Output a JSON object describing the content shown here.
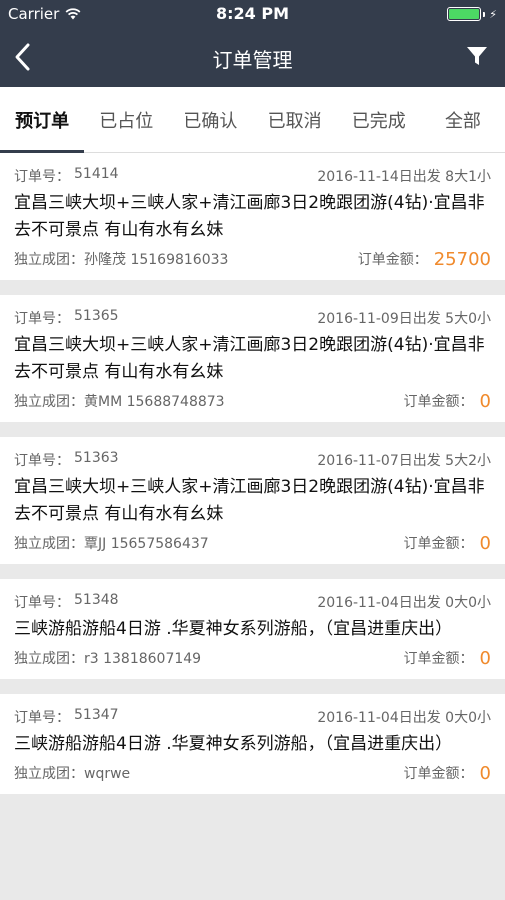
{
  "status_bar": {
    "carrier": "Carrier",
    "time": "8:24 PM"
  },
  "navbar": {
    "title": "订单管理",
    "back_icon": "chevron-left-icon",
    "filter_icon": "filter-icon"
  },
  "tabs": [
    {
      "label": "预订单",
      "active": true
    },
    {
      "label": "已占位",
      "active": false
    },
    {
      "label": "已确认",
      "active": false
    },
    {
      "label": "已取消",
      "active": false
    },
    {
      "label": "已完成",
      "active": false
    },
    {
      "label": "全部",
      "active": false
    }
  ],
  "labels": {
    "order_no": "订单号：",
    "amount": "订单金额："
  },
  "orders": [
    {
      "order_no": "51414",
      "departure": "2016-11-14日出发 8大1小",
      "desc": "宜昌三峡大坝+三峡人家+清江画廊3日2晚跟团游(4钻)·宜昌非去不可景点 有山有水有幺妹",
      "customer": "独立成团：孙隆茂 15169816033",
      "amount": "25700"
    },
    {
      "order_no": "51365",
      "departure": "2016-11-09日出发 5大0小",
      "desc": "宜昌三峡大坝+三峡人家+清江画廊3日2晚跟团游(4钻)·宜昌非去不可景点 有山有水有幺妹",
      "customer": "独立成团：黄MM 15688748873",
      "amount": "0"
    },
    {
      "order_no": "51363",
      "departure": "2016-11-07日出发 5大2小",
      "desc": "宜昌三峡大坝+三峡人家+清江画廊3日2晚跟团游(4钻)·宜昌非去不可景点 有山有水有幺妹",
      "customer": "独立成团：覃JJ 15657586437",
      "amount": "0"
    },
    {
      "order_no": "51348",
      "departure": "2016-11-04日出发 0大0小",
      "desc": "三峡游船游船4日游 .华夏神女系列游船，（宜昌进重庆出）",
      "customer": "独立成团：r3 13818607149",
      "amount": "0"
    },
    {
      "order_no": "51347",
      "departure": "2016-11-04日出发 0大0小",
      "desc": "三峡游船游船4日游 .华夏神女系列游船，（宜昌进重庆出）",
      "customer": "独立成团：wqrwe",
      "amount": "0"
    }
  ]
}
